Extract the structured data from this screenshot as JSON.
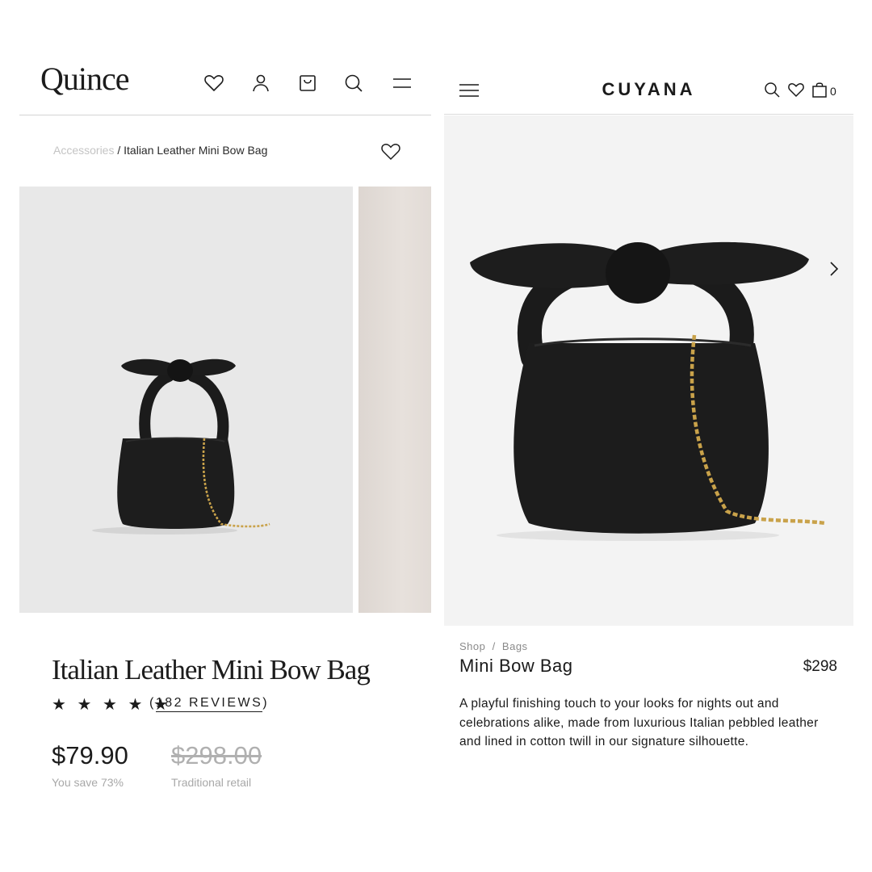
{
  "quince": {
    "logo": "Quince",
    "nav_icons": [
      "heart-icon",
      "user-icon",
      "bag-icon",
      "search-icon",
      "menu-icon"
    ],
    "breadcrumb": {
      "parent": "Accessories",
      "separator": " / ",
      "current": "Italian Leather Mini Bow Bag"
    },
    "product": {
      "title": "Italian Leather Mini Bow Bag",
      "stars": "★ ★ ★ ★ ★",
      "rating": 5,
      "reviews_open": "(",
      "reviews_label": "182 REVIEWS",
      "reviews_close": ")",
      "price": "$79.90",
      "savings": "You save 73%",
      "retail_price": "$298.00",
      "retail_label": "Traditional retail"
    },
    "colors": {
      "image_bg": "#e8e8e8",
      "text": "#1c1c1c",
      "muted": "#a8a8a8"
    }
  },
  "cuyana": {
    "logo": "CUYANA",
    "cart_count": "0",
    "nav_icons": [
      "menu-icon",
      "search-icon",
      "heart-icon",
      "bag-icon"
    ],
    "breadcrumb": "Shop  /  Bags",
    "product": {
      "name": "Mini Bow Bag",
      "price": "$298",
      "description": "A playful finishing touch to your looks for nights out and celebrations alike, made from luxurious Italian pebbled leather and lined in cotton twill in our signature silhouette."
    },
    "colors": {
      "image_bg": "#f3f3f3",
      "text": "#1a1a1a",
      "muted": "#8a8a8a"
    }
  }
}
